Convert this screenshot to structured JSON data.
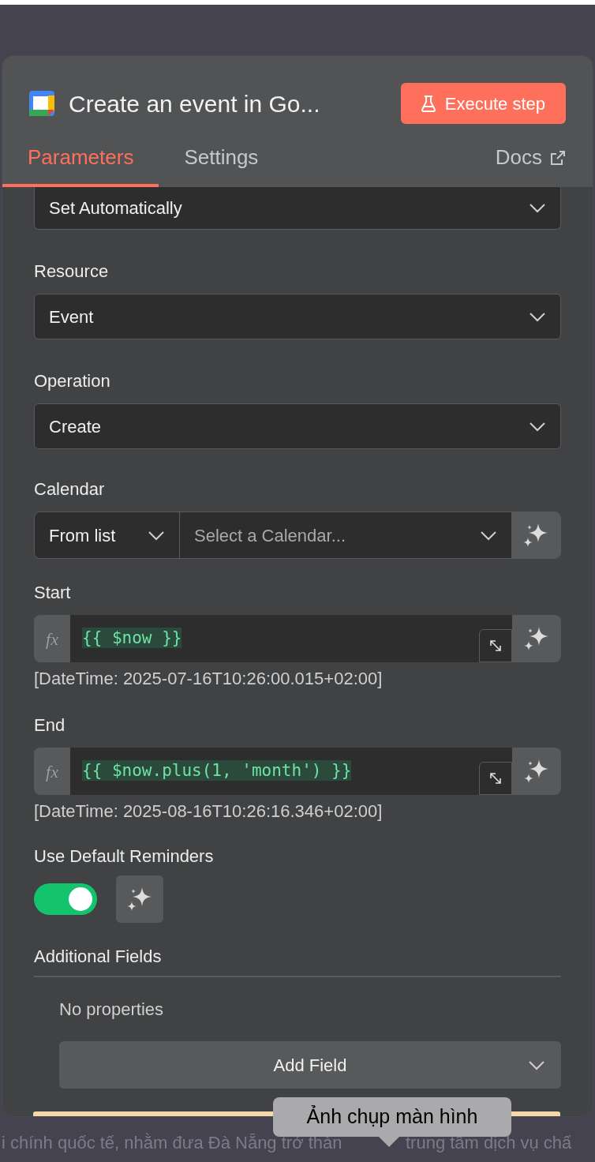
{
  "node": {
    "title": "Create an event in Go...",
    "execute_button": "Execute step"
  },
  "tabs": [
    {
      "label": "Parameters",
      "selected": true
    },
    {
      "label": "Settings",
      "selected": false
    }
  ],
  "docs_link": "Docs",
  "fields": [
    {
      "kind": "select",
      "value": "Set Automatically"
    },
    {
      "kind": "select",
      "label": "Resource",
      "value": "Event"
    },
    {
      "kind": "select",
      "label": "Operation",
      "value": "Create"
    },
    {
      "kind": "calendar",
      "label": "Calendar",
      "mode": "From list",
      "placeholder": "Select a Calendar..."
    },
    {
      "kind": "expression",
      "label": "Start",
      "value": "{{ $now }}",
      "fx": "fx",
      "hint": "[DateTime: 2025-07-16T10:26:00.015+02:00]"
    },
    {
      "kind": "expression",
      "label": "End",
      "value": "{{ $now.plus(1, 'month') }}",
      "fx": "fx",
      "hint": "[DateTime: 2025-08-16T10:26:16.346+02:00]"
    },
    {
      "kind": "toggle",
      "label": "Use Default Reminders",
      "on": true
    },
    {
      "kind": "collection",
      "label": "Additional Fields",
      "empty_text": "No properties",
      "button": "Add Field"
    }
  ],
  "background_text": [
    "i chính quốc tế, nhằm đưa Đà Nẵng trở thàn",
    "trung tâm dịch vụ chấ"
  ],
  "tooltip": "Ảnh chụp màn hình"
}
